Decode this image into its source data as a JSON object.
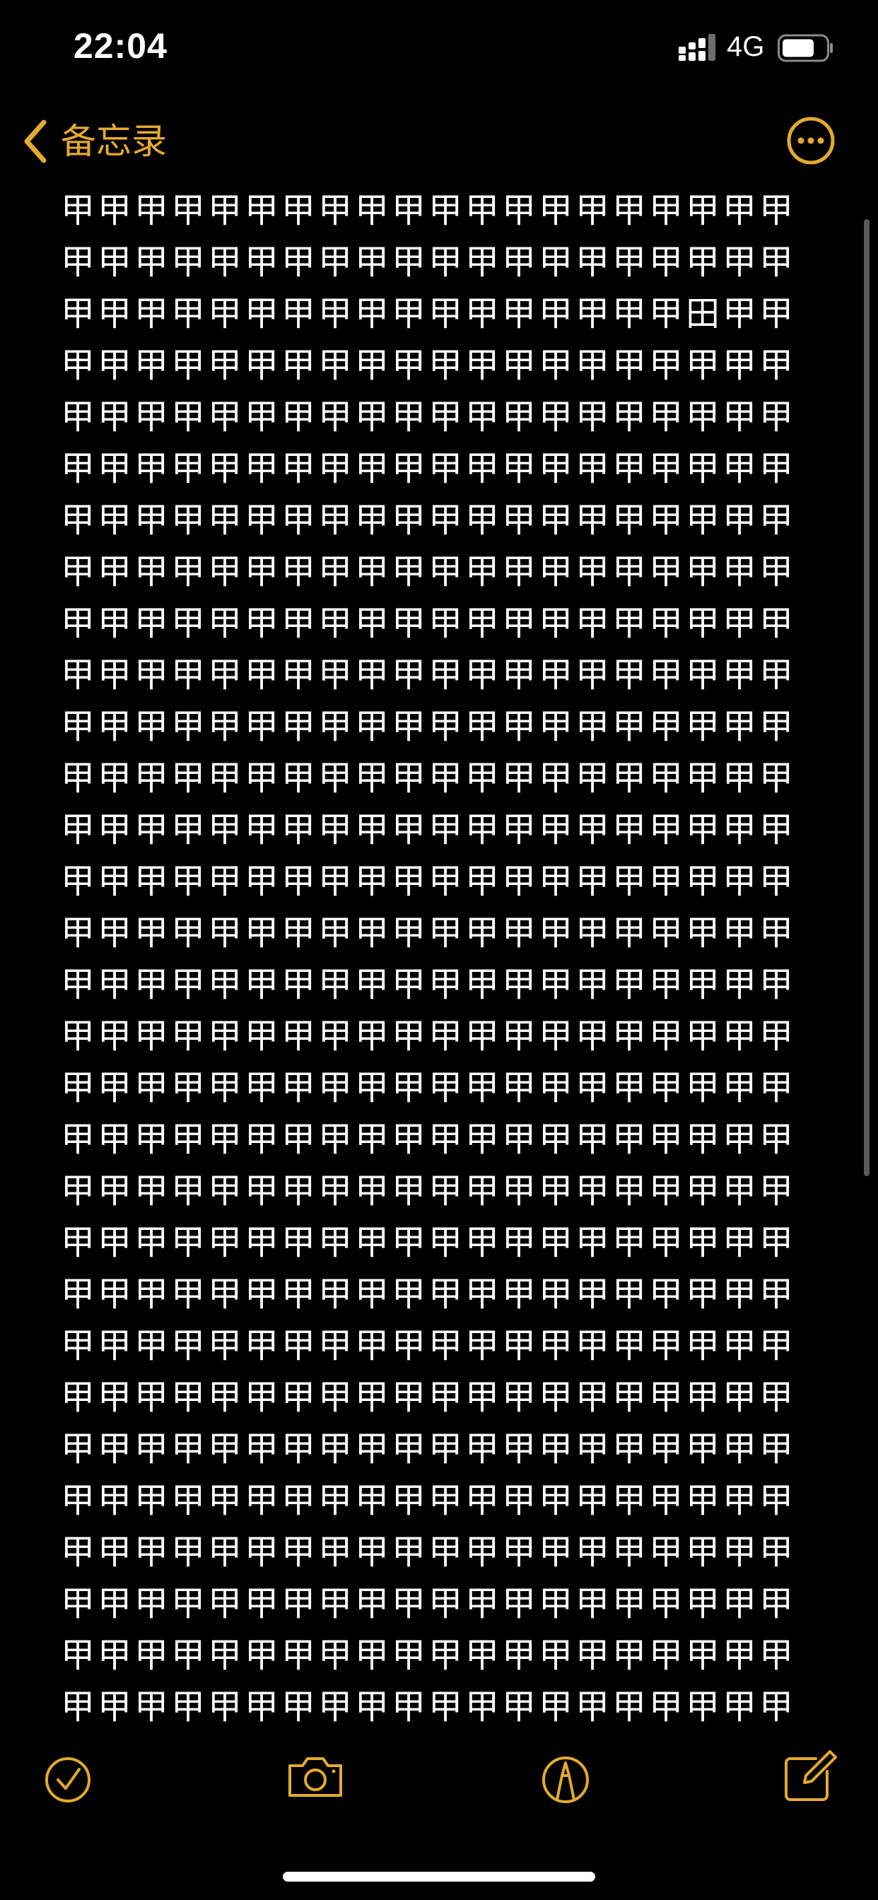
{
  "status": {
    "time": "22:04",
    "network": "4G"
  },
  "nav": {
    "back_label": "备忘录",
    "back_icon": "chevron-left-icon",
    "more_icon": "ellipsis-circle-icon"
  },
  "note": {
    "text_rows": [
      [
        "甲",
        "甲",
        "甲",
        "甲",
        "甲",
        "甲",
        "甲",
        "甲",
        "甲",
        "甲",
        "甲",
        "甲",
        "甲",
        "甲",
        "甲",
        "甲",
        "甲",
        "甲",
        "甲",
        "甲"
      ],
      [
        "甲",
        "甲",
        "甲",
        "甲",
        "甲",
        "甲",
        "甲",
        "甲",
        "甲",
        "甲",
        "甲",
        "甲",
        "甲",
        "甲",
        "甲",
        "甲",
        "甲",
        "甲",
        "甲",
        "甲"
      ],
      [
        "甲",
        "甲",
        "甲",
        "甲",
        "甲",
        "甲",
        "甲",
        "甲",
        "甲",
        "甲",
        "甲",
        "甲",
        "甲",
        "甲",
        "甲",
        "甲",
        "甲",
        "田",
        "甲",
        "甲"
      ],
      [
        "甲",
        "甲",
        "甲",
        "甲",
        "甲",
        "甲",
        "甲",
        "甲",
        "甲",
        "甲",
        "甲",
        "甲",
        "甲",
        "甲",
        "甲",
        "甲",
        "甲",
        "甲",
        "甲",
        "甲"
      ],
      [
        "甲",
        "甲",
        "甲",
        "甲",
        "甲",
        "甲",
        "甲",
        "甲",
        "甲",
        "甲",
        "甲",
        "甲",
        "甲",
        "甲",
        "甲",
        "甲",
        "甲",
        "甲",
        "甲",
        "甲"
      ],
      [
        "甲",
        "甲",
        "甲",
        "甲",
        "甲",
        "甲",
        "甲",
        "甲",
        "甲",
        "甲",
        "甲",
        "甲",
        "甲",
        "甲",
        "甲",
        "甲",
        "甲",
        "甲",
        "甲",
        "甲"
      ],
      [
        "甲",
        "甲",
        "甲",
        "甲",
        "甲",
        "甲",
        "甲",
        "甲",
        "甲",
        "甲",
        "甲",
        "甲",
        "甲",
        "甲",
        "甲",
        "甲",
        "甲",
        "甲",
        "甲",
        "甲"
      ],
      [
        "甲",
        "甲",
        "甲",
        "甲",
        "甲",
        "甲",
        "甲",
        "甲",
        "甲",
        "甲",
        "甲",
        "甲",
        "甲",
        "甲",
        "甲",
        "甲",
        "甲",
        "甲",
        "甲",
        "甲"
      ],
      [
        "甲",
        "甲",
        "甲",
        "甲",
        "甲",
        "甲",
        "甲",
        "甲",
        "甲",
        "甲",
        "甲",
        "甲",
        "甲",
        "甲",
        "甲",
        "甲",
        "甲",
        "甲",
        "甲",
        "甲"
      ],
      [
        "甲",
        "甲",
        "甲",
        "甲",
        "甲",
        "甲",
        "甲",
        "甲",
        "甲",
        "甲",
        "甲",
        "甲",
        "甲",
        "甲",
        "甲",
        "甲",
        "甲",
        "甲",
        "甲",
        "甲"
      ],
      [
        "甲",
        "甲",
        "甲",
        "甲",
        "甲",
        "甲",
        "甲",
        "甲",
        "甲",
        "甲",
        "甲",
        "甲",
        "甲",
        "甲",
        "甲",
        "甲",
        "甲",
        "甲",
        "甲",
        "甲"
      ],
      [
        "甲",
        "甲",
        "甲",
        "甲",
        "甲",
        "甲",
        "甲",
        "甲",
        "甲",
        "甲",
        "甲",
        "甲",
        "甲",
        "甲",
        "甲",
        "甲",
        "甲",
        "甲",
        "甲",
        "甲"
      ],
      [
        "甲",
        "甲",
        "甲",
        "甲",
        "甲",
        "甲",
        "甲",
        "甲",
        "甲",
        "甲",
        "甲",
        "甲",
        "甲",
        "甲",
        "甲",
        "甲",
        "甲",
        "甲",
        "甲",
        "甲"
      ],
      [
        "甲",
        "甲",
        "甲",
        "甲",
        "甲",
        "甲",
        "甲",
        "甲",
        "甲",
        "甲",
        "甲",
        "甲",
        "甲",
        "甲",
        "甲",
        "甲",
        "甲",
        "甲",
        "甲",
        "甲"
      ],
      [
        "甲",
        "甲",
        "甲",
        "甲",
        "甲",
        "甲",
        "甲",
        "甲",
        "甲",
        "甲",
        "甲",
        "甲",
        "甲",
        "甲",
        "甲",
        "甲",
        "甲",
        "甲",
        "甲",
        "甲"
      ],
      [
        "甲",
        "甲",
        "甲",
        "甲",
        "甲",
        "甲",
        "甲",
        "甲",
        "甲",
        "甲",
        "甲",
        "甲",
        "甲",
        "甲",
        "甲",
        "甲",
        "甲",
        "甲",
        "甲",
        "甲"
      ],
      [
        "甲",
        "甲",
        "甲",
        "甲",
        "甲",
        "甲",
        "甲",
        "甲",
        "甲",
        "甲",
        "甲",
        "甲",
        "甲",
        "甲",
        "甲",
        "甲",
        "甲",
        "甲",
        "甲",
        "甲"
      ],
      [
        "甲",
        "甲",
        "甲",
        "甲",
        "甲",
        "甲",
        "甲",
        "甲",
        "甲",
        "甲",
        "甲",
        "甲",
        "甲",
        "甲",
        "甲",
        "甲",
        "甲",
        "甲",
        "甲",
        "甲"
      ],
      [
        "甲",
        "甲",
        "甲",
        "甲",
        "甲",
        "甲",
        "甲",
        "甲",
        "甲",
        "甲",
        "甲",
        "甲",
        "甲",
        "甲",
        "甲",
        "甲",
        "甲",
        "甲",
        "甲",
        "甲"
      ],
      [
        "甲",
        "甲",
        "甲",
        "甲",
        "甲",
        "甲",
        "甲",
        "甲",
        "甲",
        "甲",
        "甲",
        "甲",
        "甲",
        "甲",
        "甲",
        "甲",
        "甲",
        "甲",
        "甲",
        "甲"
      ],
      [
        "甲",
        "甲",
        "甲",
        "甲",
        "甲",
        "甲",
        "甲",
        "甲",
        "甲",
        "甲",
        "甲",
        "甲",
        "甲",
        "甲",
        "甲",
        "甲",
        "甲",
        "甲",
        "甲",
        "甲"
      ],
      [
        "甲",
        "甲",
        "甲",
        "甲",
        "甲",
        "甲",
        "甲",
        "甲",
        "甲",
        "甲",
        "甲",
        "甲",
        "甲",
        "甲",
        "甲",
        "甲",
        "甲",
        "甲",
        "甲",
        "甲"
      ],
      [
        "甲",
        "甲",
        "甲",
        "甲",
        "甲",
        "甲",
        "甲",
        "甲",
        "甲",
        "甲",
        "甲",
        "甲",
        "甲",
        "甲",
        "甲",
        "甲",
        "甲",
        "甲",
        "甲",
        "甲"
      ],
      [
        "甲",
        "甲",
        "甲",
        "甲",
        "甲",
        "甲",
        "甲",
        "甲",
        "甲",
        "甲",
        "甲",
        "甲",
        "甲",
        "甲",
        "甲",
        "甲",
        "甲",
        "甲",
        "甲",
        "甲"
      ],
      [
        "甲",
        "甲",
        "甲",
        "甲",
        "甲",
        "甲",
        "甲",
        "甲",
        "甲",
        "甲",
        "甲",
        "甲",
        "甲",
        "甲",
        "甲",
        "甲",
        "甲",
        "甲",
        "甲",
        "甲"
      ],
      [
        "甲",
        "甲",
        "甲",
        "甲",
        "甲",
        "甲",
        "甲",
        "甲",
        "甲",
        "甲",
        "甲",
        "甲",
        "甲",
        "甲",
        "甲",
        "甲",
        "甲",
        "甲",
        "甲",
        "甲"
      ],
      [
        "甲",
        "甲",
        "甲",
        "甲",
        "甲",
        "甲",
        "甲",
        "甲",
        "甲",
        "甲",
        "甲",
        "甲",
        "甲",
        "甲",
        "甲",
        "甲",
        "甲",
        "甲",
        "甲",
        "甲"
      ],
      [
        "甲",
        "甲",
        "甲",
        "甲",
        "甲",
        "甲",
        "甲",
        "甲",
        "甲",
        "甲",
        "甲",
        "甲",
        "甲",
        "甲",
        "甲",
        "甲",
        "甲",
        "甲",
        "甲",
        "甲"
      ],
      [
        "甲",
        "甲",
        "甲",
        "甲",
        "甲",
        "甲",
        "甲",
        "甲",
        "甲",
        "甲",
        "甲",
        "甲",
        "甲",
        "甲",
        "甲",
        "甲",
        "甲",
        "甲",
        "甲",
        "甲"
      ],
      [
        "甲",
        "甲",
        "甲",
        "甲",
        "甲",
        "甲",
        "甲",
        "甲",
        "甲",
        "甲",
        "甲",
        "甲",
        "甲",
        "甲",
        "甲",
        "甲",
        "甲",
        "甲",
        "甲",
        "甲"
      ]
    ]
  },
  "toolbar": {
    "items": [
      {
        "icon": "checklist-icon"
      },
      {
        "icon": "camera-icon"
      },
      {
        "icon": "markup-pen-icon"
      },
      {
        "icon": "compose-icon"
      }
    ]
  },
  "colors": {
    "accent": "#e4aa2e",
    "background": "#000000",
    "text": "#ffffff"
  }
}
